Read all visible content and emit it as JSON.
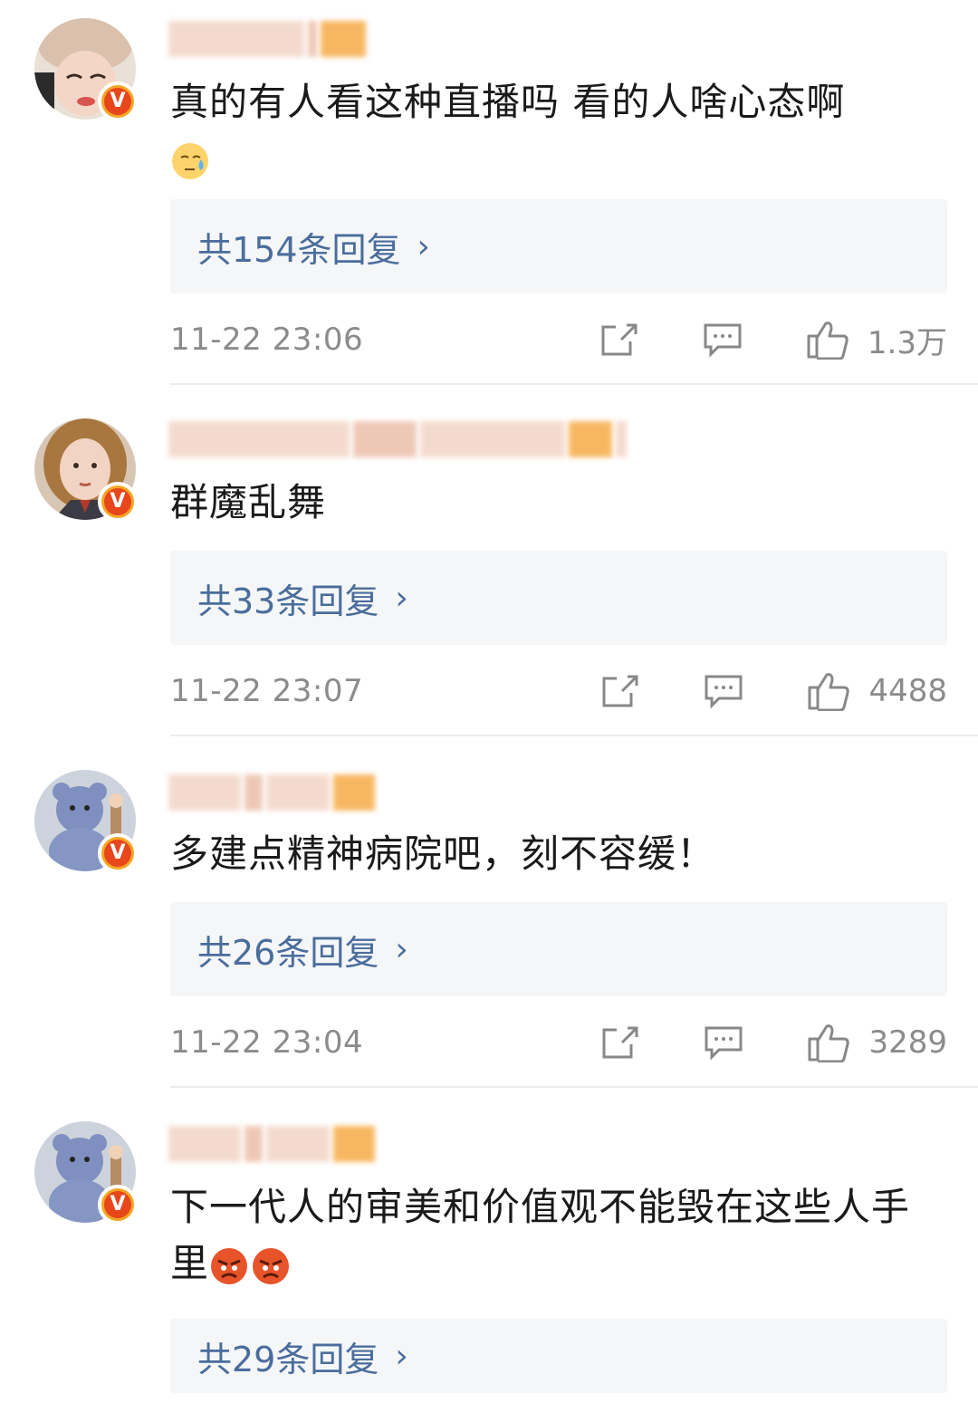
{
  "comments": [
    {
      "text": "真的有人看这种直播吗 看的人啥心态啊",
      "emoji": "sweat-emoji",
      "replies": "共154条回复",
      "time": "11-22 23:06",
      "likes": "1.3万",
      "verified_badge": "V"
    },
    {
      "text": "群魔乱舞",
      "replies": "共33条回复",
      "time": "11-22 23:07",
      "likes": "4488",
      "verified_badge": "V"
    },
    {
      "text": "多建点精神病院吧，刻不容缓！",
      "replies": "共26条回复",
      "time": "11-22 23:04",
      "likes": "3289",
      "verified_badge": "V"
    },
    {
      "text": "下一代人的审美和价值观不能毁在这些人手里",
      "emoji": "angry-emoji",
      "replies": "共29条回复",
      "verified_badge": "V"
    }
  ],
  "icons": {
    "share": "share-icon",
    "comment": "comment-icon",
    "like": "thumbs-up-icon",
    "chevron": "chevron-right-icon"
  },
  "colors": {
    "link": "#4a6d9c",
    "badge_outer": "#f5a623",
    "badge_inner": "#e8461b",
    "reply_bg": "#f5f6f8",
    "meta": "#8b8b8b"
  }
}
